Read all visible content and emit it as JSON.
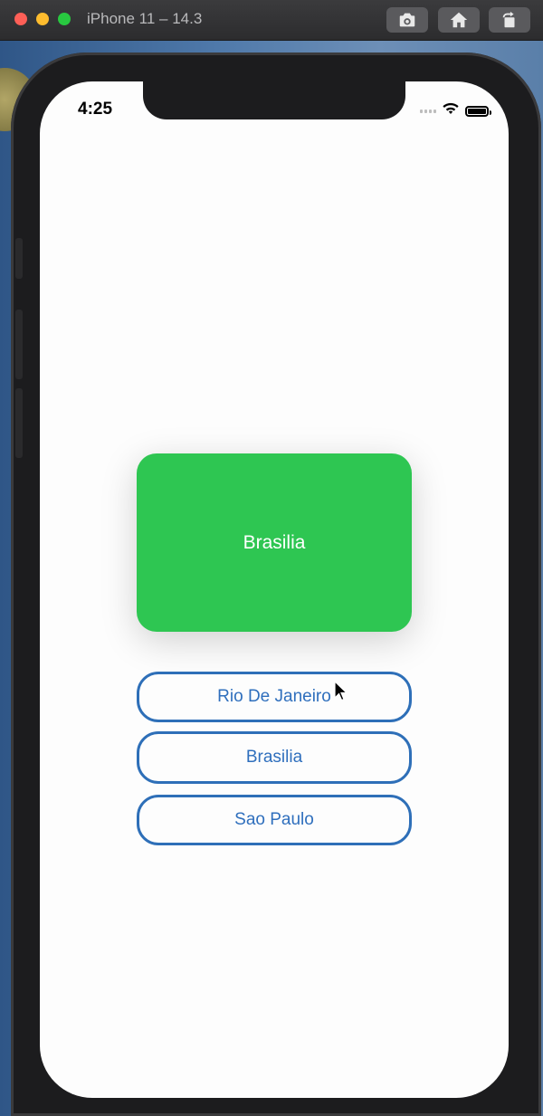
{
  "window": {
    "title": "iPhone 11 – 14.3",
    "toolbar": [
      "screenshot-icon",
      "home-icon",
      "rotate-icon"
    ]
  },
  "status_bar": {
    "time": "4:25",
    "icons": [
      "cellular-signal-icon",
      "wifi-icon",
      "battery-icon"
    ]
  },
  "quiz": {
    "flag_label": "Brasilia",
    "flag_color": "#2ec652",
    "answers": [
      "Rio De Janeiro",
      "Brasilia",
      "Sao Paulo"
    ],
    "answer_border_color": "#2e6fb8"
  }
}
